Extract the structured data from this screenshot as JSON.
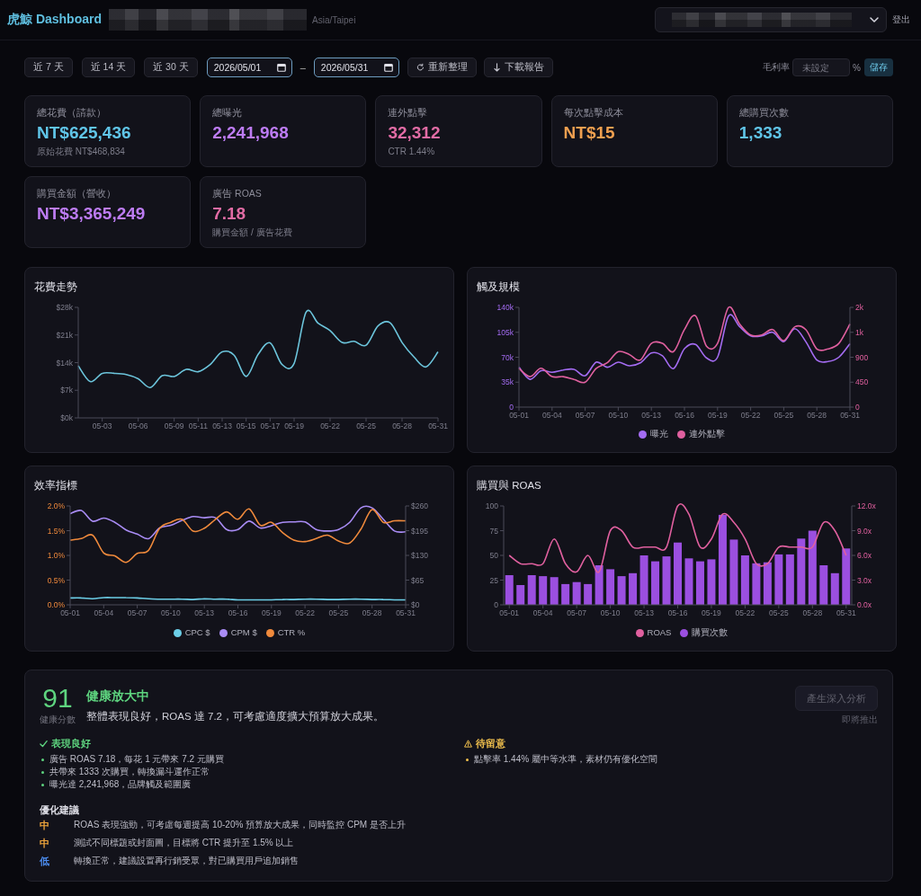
{
  "header": {
    "brand": "虎鯨 Dashboard",
    "timezone": "Asia/Taipei",
    "logout": "登出"
  },
  "toolbar": {
    "ranges": [
      {
        "label": "近 7 天",
        "selected": false
      },
      {
        "label": "近 14 天",
        "selected": false
      },
      {
        "label": "近 30 天",
        "selected": false
      }
    ],
    "date_from": "2026/05/01",
    "date_separator": "–",
    "date_to": "2026/05/31",
    "refresh": "重新整理",
    "download": "下載報告",
    "margin": {
      "label": "毛利率",
      "placeholder": "未設定",
      "unit": "%",
      "save": "儲存"
    }
  },
  "kpis": [
    {
      "label": "總花費（請款）",
      "value": "NT$625,436",
      "color": "#60c5e8",
      "sub": "原始花費 NT$468,834"
    },
    {
      "label": "總曝光",
      "value": "2,241,968",
      "color": "#bd7cf4"
    },
    {
      "label": "連外點擊",
      "value": "32,312",
      "color": "#e26ca5",
      "sub": "CTR 1.44%"
    },
    {
      "label": "每次點擊成本",
      "value": "NT$15",
      "color": "#f0a050"
    },
    {
      "label": "總購買次數",
      "value": "1,333",
      "color": "#60c5e8"
    },
    {
      "label": "購買金額（營收）",
      "value": "NT$3,365,249",
      "color": "#bd7cf4"
    },
    {
      "label": "廣告 ROAS",
      "value": "7.18",
      "color": "#e26ca5",
      "sub": "購買金額 / 廣告花費"
    }
  ],
  "charts": [
    {
      "chart_data": {
        "type": "line",
        "title": "花費走勢",
        "categories": [
          null,
          null,
          "05-03",
          null,
          null,
          "05-06",
          null,
          null,
          "05-09",
          null,
          "05-11",
          null,
          "05-13",
          null,
          "05-15",
          null,
          "05-17",
          null,
          "05-19",
          null,
          null,
          "05-22",
          null,
          null,
          "05-25",
          null,
          null,
          "05-28",
          null,
          null,
          "05-31"
        ],
        "ylim": [
          0,
          28000
        ],
        "yticks": [
          {
            "value": 0,
            "label": "$0k"
          },
          {
            "value": 7000,
            "label": "$7k"
          },
          {
            "value": 14000,
            "label": "$14k"
          },
          {
            "value": 21000,
            "label": "$21k"
          },
          {
            "value": 28000,
            "label": "$28k"
          }
        ],
        "series": [
          {
            "color": "#6cc5dc",
            "values": [
              13200,
              9200,
              11300,
              11300,
              11000,
              9900,
              7700,
              10700,
              10500,
              12300,
              11700,
              13500,
              16700,
              15900,
              10500,
              16100,
              19000,
              13500,
              13800,
              26800,
              24000,
              22100,
              19100,
              19400,
              18400,
              23300,
              24100,
              19100,
              15400,
              12900,
              16700
            ]
          }
        ]
      }
    },
    {
      "chart_data": {
        "type": "line",
        "title": "觸及規模",
        "legend": true,
        "categories": [
          "05-01",
          null,
          null,
          "05-04",
          null,
          null,
          "05-07",
          null,
          null,
          "05-10",
          null,
          null,
          "05-13",
          null,
          null,
          "05-16",
          null,
          null,
          "05-19",
          null,
          null,
          "05-22",
          null,
          null,
          "05-25",
          null,
          null,
          "05-28",
          null,
          null,
          "05-31"
        ],
        "ylim": [
          0,
          140000
        ],
        "yticks": [
          {
            "value": 0,
            "label": "0"
          },
          {
            "value": 35000,
            "label": "35k"
          },
          {
            "value": 70000,
            "label": "70k"
          },
          {
            "value": 105000,
            "label": "105k"
          },
          {
            "value": 140000,
            "label": "140k"
          }
        ],
        "y2lim": [
          0,
          1800
        ],
        "y2ticks": [
          {
            "value": 0,
            "label": "0"
          },
          {
            "value": 450,
            "label": "450"
          },
          {
            "value": 900,
            "label": "900"
          },
          {
            "value": 1350,
            "label": "1k"
          },
          {
            "value": 1800,
            "label": "2k"
          }
        ],
        "series": [
          {
            "name": "曝光",
            "color": "#a46cf2",
            "values": [
              56000,
              39000,
              51000,
              49000,
              52000,
              53000,
              44000,
              63000,
              56000,
              63000,
              58000,
              62000,
              76000,
              72000,
              54000,
              82000,
              88000,
              69000,
              70000,
              128000,
              113000,
              100000,
              100000,
              105000,
              92000,
              110000,
              92000,
              66000,
              64000,
              70000,
              89000
            ]
          },
          {
            "name": "連外點擊",
            "color": "#e0609f",
            "axis": "y2",
            "values": [
              700,
              550,
              700,
              550,
              550,
              500,
              450,
              700,
              800,
              1000,
              950,
              850,
              1150,
              1150,
              1000,
              1400,
              1650,
              1100,
              1150,
              1800,
              1500,
              1300,
              1300,
              1400,
              1200,
              1450,
              1400,
              1050,
              1050,
              1150,
              1500
            ]
          }
        ]
      }
    },
    {
      "chart_data": {
        "type": "line",
        "title": "效率指標",
        "legend": true,
        "categories": [
          "05-01",
          null,
          null,
          "05-04",
          null,
          null,
          "05-07",
          null,
          null,
          "05-10",
          null,
          null,
          "05-13",
          null,
          null,
          "05-16",
          null,
          null,
          "05-19",
          null,
          null,
          "05-22",
          null,
          null,
          "05-25",
          null,
          null,
          "05-28",
          null,
          null,
          "05-31"
        ],
        "ylim": [
          0,
          2
        ],
        "yticks": [
          {
            "value": 0,
            "label": "0.0%"
          },
          {
            "value": 0.5,
            "label": "0.5%"
          },
          {
            "value": 1,
            "label": "1.0%"
          },
          {
            "value": 1.5,
            "label": "1.5%"
          },
          {
            "value": 2,
            "label": "2.0%"
          }
        ],
        "y2lim": [
          0,
          260
        ],
        "y2ticks": [
          {
            "value": 0,
            "label": "$0"
          },
          {
            "value": 65,
            "label": "$65"
          },
          {
            "value": 130,
            "label": "$130"
          },
          {
            "value": 195,
            "label": "$195"
          },
          {
            "value": 260,
            "label": "$260"
          }
        ],
        "series": [
          {
            "name": "CPC $",
            "color": "#6ccfe8",
            "axis": "y2",
            "values": [
              18,
              18,
              16,
              19,
              19,
              19,
              18,
              16,
              15,
              15,
              15,
              14,
              16,
              15,
              15,
              13,
              13,
              13,
              13,
              14,
              14,
              15,
              15,
              14,
              14,
              15,
              15,
              14,
              14,
              13,
              13
            ]
          },
          {
            "name": "CPM $",
            "color": "#a98cf5",
            "axis": "y2",
            "values": [
              240,
              248,
              220,
              228,
              217,
              197,
              186,
              174,
              202,
              209,
              222,
              232,
              229,
              229,
              198,
              198,
              220,
              202,
              208,
              217,
              218,
              218,
              198,
              194,
              198,
              217,
              255,
              255,
              225,
              194,
              192
            ]
          },
          {
            "name": "CTR %",
            "color": "#f08a3c",
            "values": [
              1.31,
              1.34,
              1.41,
              1.05,
              0.99,
              0.86,
              1.04,
              1.1,
              1.55,
              1.67,
              1.73,
              1.49,
              1.55,
              1.73,
              1.88,
              1.73,
              1.94,
              1.61,
              1.67,
              1.46,
              1.31,
              1.28,
              1.34,
              1.41,
              1.29,
              1.25,
              1.53,
              1.93,
              1.67,
              1.7,
              1.7
            ]
          }
        ]
      }
    },
    {
      "chart_data": {
        "type": "bar",
        "title": "購買與 ROAS",
        "legend": true,
        "categories": [
          "05-01",
          null,
          null,
          "05-04",
          null,
          null,
          "05-07",
          null,
          null,
          "05-10",
          null,
          null,
          "05-13",
          null,
          null,
          "05-16",
          null,
          null,
          "05-19",
          null,
          null,
          "05-22",
          null,
          null,
          "05-25",
          null,
          null,
          "05-28",
          null,
          null,
          "05-31"
        ],
        "ylim": [
          0,
          100
        ],
        "yticks": [
          0,
          25,
          50,
          75,
          100
        ],
        "y2lim": [
          0,
          12
        ],
        "y2ticks": [
          {
            "value": 0,
            "label": "0.0x"
          },
          {
            "value": 3,
            "label": "3.0x"
          },
          {
            "value": 6,
            "label": "6.0x"
          },
          {
            "value": 9,
            "label": "9.0x"
          },
          {
            "value": 12,
            "label": "12.0x"
          }
        ],
        "series": [
          {
            "name": "ROAS",
            "type": "line",
            "color": "#e0609f",
            "axis": "y2",
            "values": [
              6,
              5,
              5,
              5,
              8,
              5,
              4,
              6,
              4,
              9,
              9,
              7,
              7,
              7,
              7,
              12,
              11,
              7,
              8,
              11,
              10,
              8,
              5,
              5,
              7,
              7,
              7,
              7,
              10,
              9,
              6
            ]
          },
          {
            "name": "購買次數",
            "type": "bar",
            "color": "#9b4fe0",
            "values": [
              30,
              20,
              30,
              29,
              28,
              21,
              23,
              21,
              40,
              36,
              29,
              32,
              50,
              44,
              49,
              63,
              47,
              44,
              46,
              91,
              66,
              50,
              42,
              43,
              51,
              51,
              67,
              75,
              40,
              32,
              57
            ]
          }
        ]
      }
    }
  ],
  "analysis": {
    "score": "91",
    "score_label": "健康分數",
    "status": "健康放大中",
    "summary": "整體表現良好，ROAS 達 7.2，可考慮適度擴大預算放大成果。",
    "action": {
      "label": "產生深入分析",
      "disabled": true
    },
    "action_note": "即將推出",
    "findings": [
      {
        "kind": "good",
        "title": "表現良好",
        "items": [
          "廣告 ROAS 7.18，每花 1 元帶來 7.2 元購買",
          "共帶來 1333 次購買，轉換漏斗運作正常",
          "曝光達 2,241,968，品牌觸及範圍廣"
        ]
      },
      {
        "kind": "warning",
        "title": "待留意",
        "items": [
          "點擊率 1.44% 屬中等水準，素材仍有優化空間"
        ]
      }
    ],
    "suggestions": {
      "title": "優化建議",
      "items": [
        {
          "priority": "中",
          "color": "#f0a63c",
          "text": "ROAS 表現強勁，可考慮每週提高 10-20% 預算放大成果，同時監控 CPM 是否上升"
        },
        {
          "priority": "中",
          "color": "#f0a63c",
          "text": "測試不同標題或封面圖，目標將 CTR 提升至 1.5% 以上"
        },
        {
          "priority": "低",
          "color": "#4c8df0",
          "text": "轉換正常，建議設置再行銷受眾，對已購買用戶追加銷售"
        }
      ]
    }
  }
}
